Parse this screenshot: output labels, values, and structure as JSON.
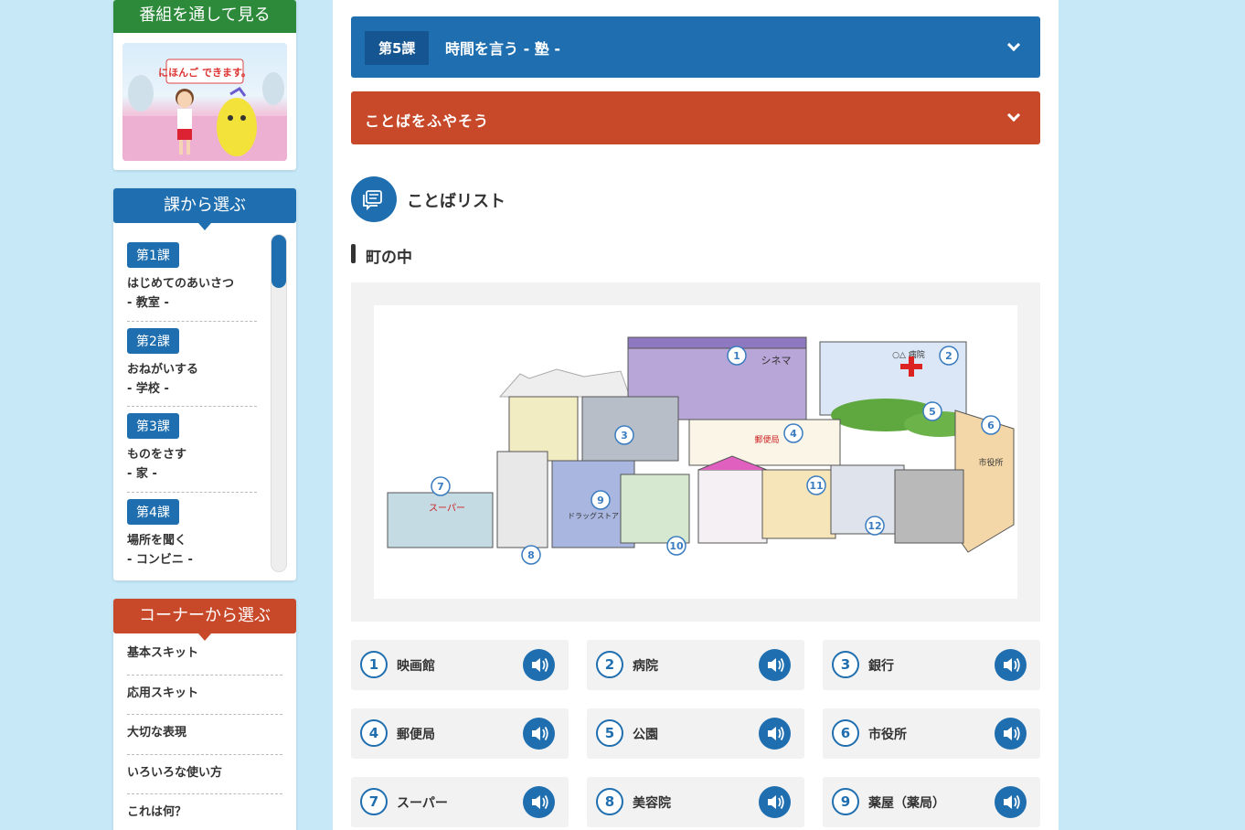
{
  "sidebar": {
    "watch_title": "番組を通して見る",
    "thumb_logo": "にほんご できます。",
    "lessons_title": "課から選ぶ",
    "lessons": [
      {
        "badge": "第1課",
        "title": "はじめてのあいさつ",
        "place": "- 教室 -"
      },
      {
        "badge": "第2課",
        "title": "おねがいする",
        "place": "- 学校 -"
      },
      {
        "badge": "第3課",
        "title": "ものをさす",
        "place": "- 家 -"
      },
      {
        "badge": "第4課",
        "title": "場所を聞く",
        "place": "- コンビニ -"
      }
    ],
    "corners_title": "コーナーから選ぶ",
    "corners": [
      "基本スキット",
      "応用スキット",
      "大切な表現",
      "いろいろな使い方",
      "これは何？"
    ]
  },
  "main": {
    "lesson_badge": "第5課",
    "lesson_title": "時間を言う - 塾 -",
    "vocab_header": "ことばをふやそう",
    "list_title": "ことばリスト",
    "section_title": "町の中",
    "map_labels": [
      "シネマ",
      "○△ 病院",
      "郵便局",
      "スーパー",
      "ドラッグストア",
      "市役所"
    ],
    "words": [
      {
        "num": "1",
        "word": "映画館"
      },
      {
        "num": "2",
        "word": "病院"
      },
      {
        "num": "3",
        "word": "銀行"
      },
      {
        "num": "4",
        "word": "郵便局"
      },
      {
        "num": "5",
        "word": "公園"
      },
      {
        "num": "6",
        "word": "市役所"
      },
      {
        "num": "7",
        "word": "スーパー"
      },
      {
        "num": "8",
        "word": "美容院"
      },
      {
        "num": "9",
        "word": "薬屋（薬局）"
      }
    ]
  },
  "colors": {
    "blue": "#1f6fb0",
    "red": "#c8482a",
    "green": "#2c8a3a",
    "bg": "#c6e8f7"
  }
}
